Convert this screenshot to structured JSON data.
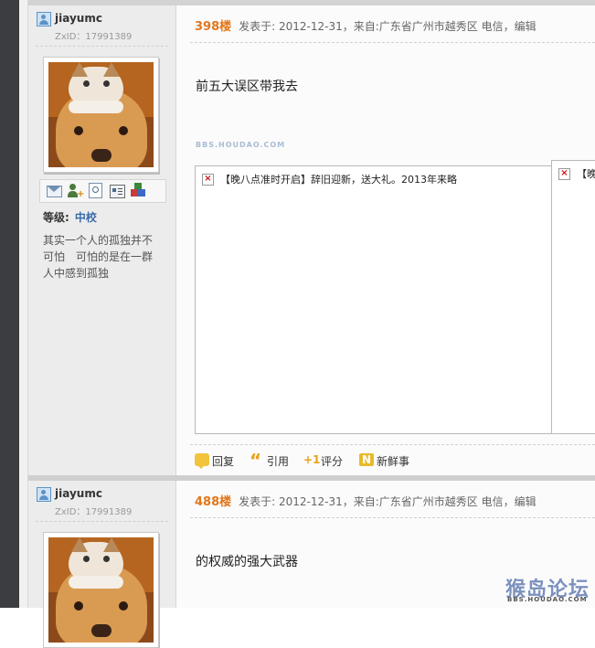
{
  "posts": [
    {
      "username": "jiayumc",
      "zxid": "ZxID：17991389",
      "level_label": "等级:",
      "level_value": "中校",
      "signature": "其实一个人的孤独并不可怕　可怕的是在一群人中感到孤独",
      "floor": "398楼",
      "meta": "发表于: 2012-12-31，来自:广东省广州市越秀区 电信，编辑",
      "content": "前五大误区带我去",
      "watermark": "BBS.HOUDAO.COM",
      "embed_main_text": "【晚八点准时开启】辞旧迎新，送大礼。2013年来略",
      "embed_side_text": "【晚",
      "actions": {
        "reply": "回复",
        "quote": "引用",
        "rate": "评分",
        "news": "新鲜事"
      }
    },
    {
      "username": "jiayumc",
      "zxid": "ZxID：17991389",
      "floor": "488楼",
      "meta": "发表于: 2012-12-31，来自:广东省广州市越秀区 电信，编辑",
      "content": "的权威的强大武器"
    }
  ],
  "icons": {
    "user": "user-icon",
    "message": "message-icon",
    "add_friend": "add-friend-icon",
    "search": "search-icon",
    "profile": "profile-icon",
    "apps": "apps-icon",
    "broken_image": "broken-image-icon",
    "reply": "reply-icon",
    "quote": "quote-icon",
    "rate": "rate-icon",
    "news": "news-icon"
  },
  "colors": {
    "floor": "#e2771d",
    "level": "#3a6aa8",
    "sidebar_bg": "#ececec",
    "left_strip": "#3c3d40"
  },
  "site_logo": {
    "cn": "猴岛论坛",
    "en": "BBS.HOUDAO.COM"
  }
}
